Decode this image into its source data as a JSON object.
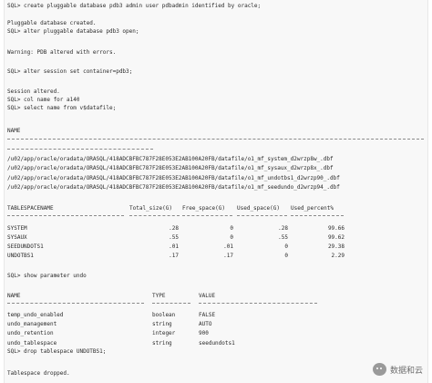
{
  "session": [
    "SQL> create pluggable database pdb3 admin user pdbadmin identified by oracle;",
    "Pluggable database created.",
    "SQL> alter pluggable database pdb3 open;",
    "Warning: PDB altered with errors.",
    "SQL> alter session set container=pdb3;",
    "Session altered.",
    "SQL> col name for a140",
    "SQL> select name from v$datafile;"
  ],
  "datafiles": {
    "header": "NAME",
    "rows": [
      "/u02/app/oracle/oradata/ORASQL/418ADCBFBC787F28E053E2AB100A20FB/datafile/o1_mf_system_d2wrzp8w_.dbf",
      "/u02/app/oracle/oradata/ORASQL/418ADCBFBC787F28E053E2AB100A20FB/datafile/o1_mf_sysaux_d2wrzp8x_.dbf",
      "/u02/app/oracle/oradata/ORASQL/418ADCBFBC787F28E053E2AB100A20FB/datafile/o1_mf_undotbs1_d2wrzp90_.dbf",
      "/u02/app/oracle/oradata/ORASQL/418ADCBFBC787F28E053E2AB100A20FB/datafile/o1_mf_seedundo_d2wrzp94_.dbf"
    ]
  },
  "tablespaces": {
    "headers": [
      "TABLESPACENAME",
      "Total_size(G)",
      "Free_space(G)",
      "Used_space(G)",
      "Used_percent%"
    ],
    "rows": [
      [
        "SYSTEM",
        ".28",
        "0",
        ".28",
        "99.66"
      ],
      [
        "SYSAUX",
        ".55",
        "0",
        ".55",
        "99.62"
      ],
      [
        "SEEDUNDOTS1",
        ".01",
        ".01",
        "0",
        "29.38"
      ],
      [
        "UNDOTBS1",
        ".17",
        ".17",
        "0",
        "2.29"
      ]
    ]
  },
  "undo_cmd": "SQL> show parameter undo",
  "parameters": {
    "headers": [
      "NAME",
      "TYPE",
      "VALUE"
    ],
    "rows": [
      [
        "temp_undo_enabled",
        "boolean",
        "FALSE"
      ],
      [
        "undo_management",
        "string",
        "AUTO"
      ],
      [
        "undo_retention",
        "integer",
        "900"
      ],
      [
        "undo_tablespace",
        "string",
        "seedundots1"
      ]
    ]
  },
  "drop": [
    "SQL> drop tablespace UNDOTBS1;",
    "Tablespace dropped."
  ],
  "watermark": {
    "text": "数据和云",
    "icon": "wechat-icon"
  }
}
